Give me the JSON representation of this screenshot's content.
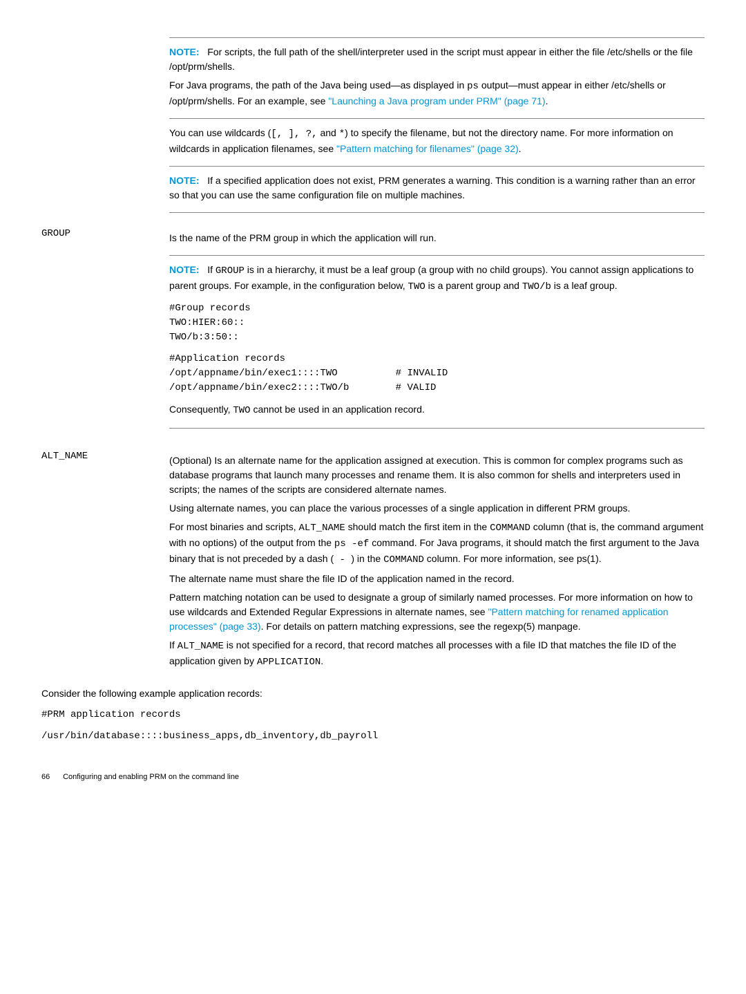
{
  "block1": {
    "note_label": "NOTE:",
    "note1_text": "For scripts, the full path of the shell/interpreter used in the script must appear in either the file /etc/shells or the file /opt/prm/shells.",
    "java1_pre": "For Java programs, the path of the Java being used—as displayed in ",
    "java1_code": "ps",
    "java1_mid": " output—must appear in either /etc/shells or /opt/prm/shells. For an example, see ",
    "java1_link": "\"Launching a Java program under PRM\" (page 71)",
    "java1_end": ".",
    "wild_pre": "You can use wildcards (",
    "wild_codes": "[, ], ?,",
    "wild_and": " and ",
    "wild_star": "*",
    "wild_mid": ") to specify the filename, but not the directory name. For more information on wildcards in application filenames, see ",
    "wild_link": "\"Pattern matching for filenames\" (page 32)",
    "wild_end": ".",
    "note3_text": "If a specified application does not exist, PRM generates a warning. This condition is a warning rather than an error so that you can use the same configuration file on multiple machines."
  },
  "group": {
    "term": "GROUP",
    "desc": "Is the name of the PRM group in which the application will run.",
    "note_label": "NOTE:",
    "note_pre": "If ",
    "note_code1": "GROUP",
    "note_mid1": " is in a hierarchy, it must be a leaf group (a group with no child groups). You cannot assign applications to parent groups. For example, in the configuration below, ",
    "note_code2": "TWO",
    "note_mid2": " is a parent group and ",
    "note_code3": "TWO/b",
    "note_end": " is a leaf group.",
    "code1": "#Group records\nTWO:HIER:60::\nTWO/b:3:50::",
    "code2": "#Application records\n/opt/appname/bin/exec1::::TWO          # INVALID\n/opt/appname/bin/exec2::::TWO/b        # VALID",
    "cons_pre": "Consequently, ",
    "cons_code": "TWO",
    "cons_end": " cannot be used in an application record."
  },
  "alt": {
    "term": "ALT_NAME",
    "para1": "(Optional) Is an alternate name for the application assigned at execution. This is common for complex programs such as database programs that launch many processes and rename them. It is also common for shells and interpreters used in scripts; the names of the scripts are considered alternate names.",
    "para2": "Using alternate names, you can place the various processes of a single application in different PRM groups.",
    "p3_pre": "For most binaries and scripts, ",
    "p3_c1": "ALT_NAME",
    "p3_m1": " should match the first item in the ",
    "p3_c2": "COMMAND",
    "p3_m2": " column (that is, the command argument with no options) of the output from the ",
    "p3_c3": "ps -ef",
    "p3_m3": " command. For Java programs, it should match the first argument to the Java binary that is not preceded by a dash (",
    "p3_c4": " - ",
    "p3_m4": ") in the ",
    "p3_c5": "COMMAND",
    "p3_m5": " column. For more information, see ps(1).",
    "para4": "The alternate name must share the file ID of the application named in the record.",
    "p5_pre": "Pattern matching notation can be used to designate a group of similarly named processes. For more information on how to use wildcards and Extended Regular Expressions in alternate names, see ",
    "p5_link": "\"Pattern matching for renamed application processes\" (page 33)",
    "p5_end": ". For details on pattern matching expressions, see the regexp(5) manpage.",
    "p6_pre": "If ",
    "p6_c1": "ALT_NAME",
    "p6_m1": " is not specified for a record, that record matches all processes with a file ID that matches the file ID of the application given by ",
    "p6_c2": "APPLICATION",
    "p6_end": "."
  },
  "consider": "Consider the following example application records:",
  "example1": "#PRM application records",
  "example2": "/usr/bin/database::::business_apps,db_inventory,db_payroll",
  "footer": {
    "page": "66",
    "title": "Configuring and enabling PRM on the command line"
  }
}
